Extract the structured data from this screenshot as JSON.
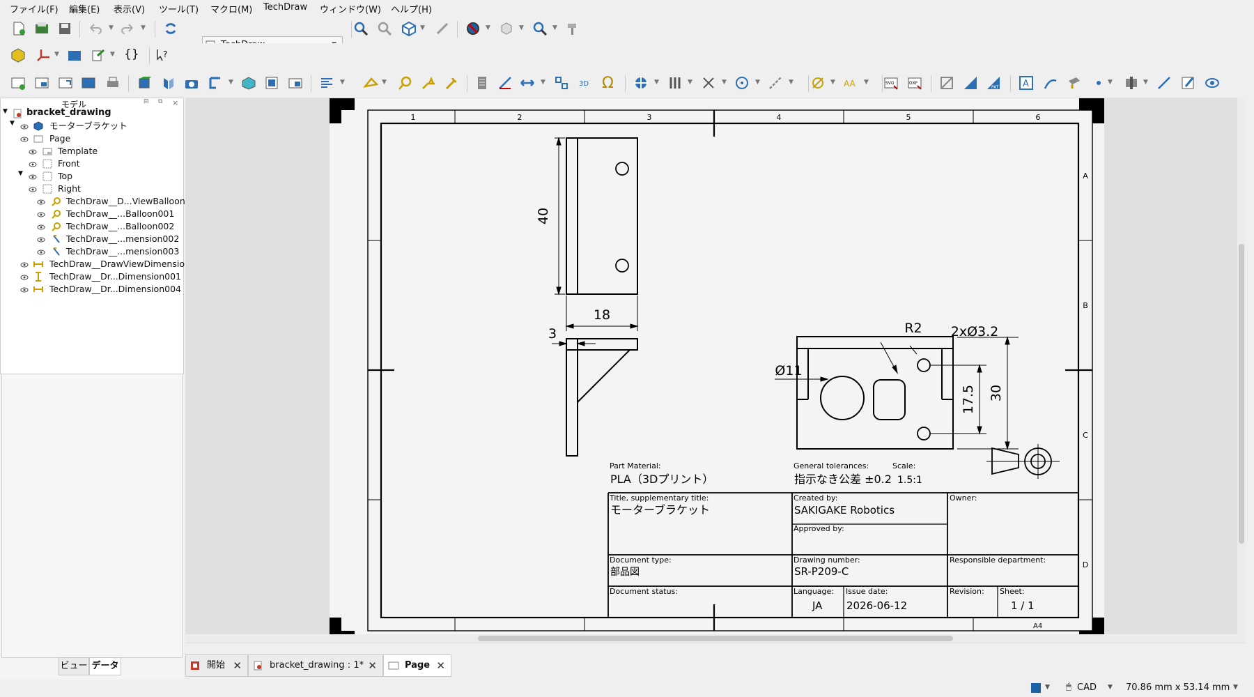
{
  "menu": [
    "ファイル(F)",
    "編集(E)",
    "表示(V)",
    "ツール(T)",
    "マクロ(M)",
    "TechDraw",
    "ウィンドウ(W)",
    "ヘルプ(H)"
  ],
  "toolbar": {
    "workbench": "TechDraw"
  },
  "model_panel": {
    "title": "モデル",
    "tree": [
      {
        "label": "bracket_drawing",
        "bold": true
      },
      {
        "label": "モーターブラケット"
      },
      {
        "label": "Page"
      },
      {
        "label": "Template"
      },
      {
        "label": "Front"
      },
      {
        "label": "Top"
      },
      {
        "label": "Right"
      },
      {
        "label": "TechDraw__D...ViewBalloon"
      },
      {
        "label": "TechDraw__...Balloon001"
      },
      {
        "label": "TechDraw__...Balloon002"
      },
      {
        "label": "TechDraw__...mension002"
      },
      {
        "label": "TechDraw__...mension003"
      },
      {
        "label": "TechDraw__DrawViewDimensior"
      },
      {
        "label": "TechDraw__Dr...Dimension001"
      },
      {
        "label": "TechDraw__Dr...Dimension004"
      }
    ],
    "bottom_tabs": [
      "ビュー",
      "データ"
    ]
  },
  "doc_tabs": [
    {
      "label": "開始"
    },
    {
      "label": "bracket_drawing : 1*"
    },
    {
      "label": "Page",
      "active": true
    }
  ],
  "drawing": {
    "col_numbers": [
      "1",
      "2",
      "3",
      "4",
      "5",
      "6"
    ],
    "row_letters": [
      "A",
      "B",
      "C",
      "D"
    ],
    "dims": {
      "d40": "40",
      "d18": "18",
      "d3": "3",
      "r2": "R2",
      "holes": "2xØ3.2",
      "dia11": "Ø11",
      "d17_5": "17.5",
      "d30": "30"
    },
    "part_material_label": "Part Material:",
    "part_material": "PLA（3Dプリント）",
    "general_tol_label": "General tolerances:",
    "general_tol": "指示なき公差 ±0.2",
    "scale_label": "Scale:",
    "scale": "1.5:1",
    "title_label": "Title, supplementary title:",
    "title": "モーターブラケット",
    "created_by_label": "Created by:",
    "created_by": "SAKIGAKE Robotics",
    "approved_by_label": "Approved by:",
    "owner_label": "Owner:",
    "doc_type_label": "Document type:",
    "doc_type": "部品図",
    "drawing_number_label": "Drawing number:",
    "drawing_number": "SR-P209-C",
    "resp_dept_label": "Responsible department:",
    "doc_status_label": "Document status:",
    "language_label": "Language:",
    "language": "JA",
    "issue_date_label": "Issue date:",
    "issue_date": "2026-06-12",
    "revision_label": "Revision:",
    "sheet_label": "Sheet:",
    "sheet": "1 / 1",
    "paper": "A4"
  },
  "status": {
    "nav": "CAD",
    "dimensions": "70.86 mm x 53.14 mm"
  }
}
